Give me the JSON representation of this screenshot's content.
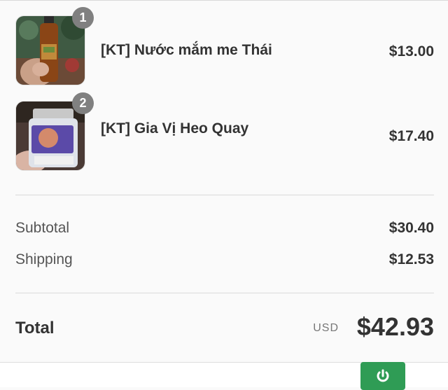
{
  "items": [
    {
      "badge": "1",
      "name": "[KT] Nước mắm me Thái",
      "price": "$13.00"
    },
    {
      "badge": "2",
      "name": "[KT] Gia Vị Heo Quay",
      "price": "$17.40"
    }
  ],
  "summary": {
    "subtotal_label": "Subtotal",
    "subtotal_value": "$30.40",
    "shipping_label": "Shipping",
    "shipping_value": "$12.53"
  },
  "total": {
    "label": "Total",
    "currency": "USD",
    "value": "$42.93"
  },
  "colors": {
    "accent": "#2f9c55",
    "badge": "#808080"
  }
}
